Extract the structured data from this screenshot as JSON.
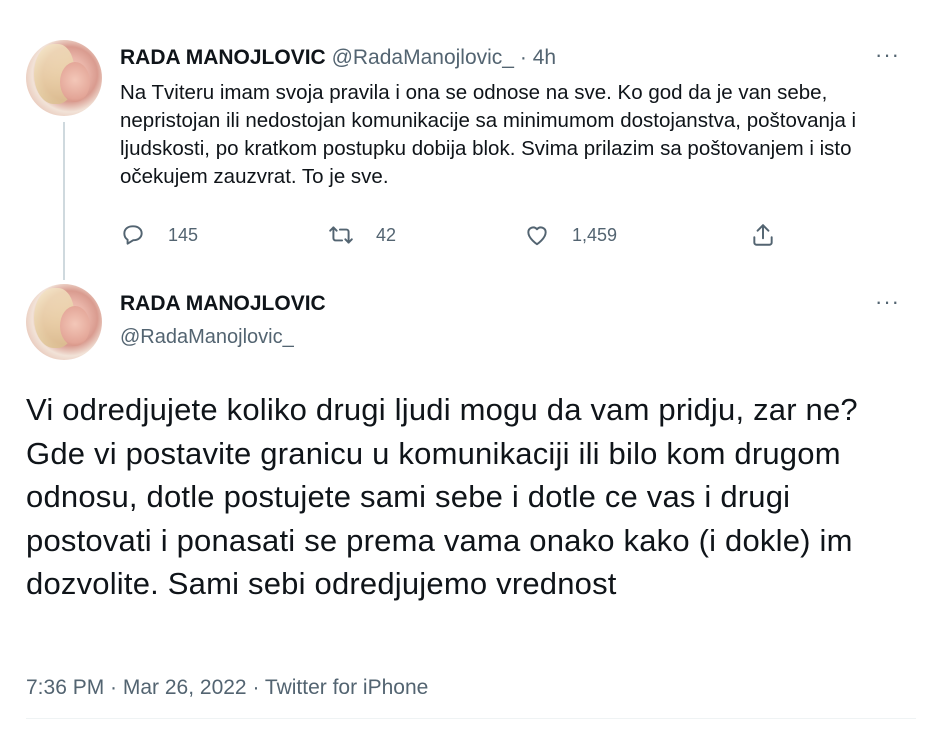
{
  "tweet1": {
    "name": "RADA MANOJLOVIC",
    "handle": "@RadaManojlovic_",
    "separator": "·",
    "time": "4h",
    "text": "Na Tviteru imam svoja pravila i ona se odnose na sve. Ko god da je van sebe, nepristojan ili nedostojan komunikacije sa minimumom dostojanstva, poštovanja i ljudskosti, po kratkom postupku dobija blok. Svima prilazim sa poštovanjem i isto očekujem zauzvrat. To je sve.",
    "more_label": "···",
    "actions": {
      "reply_count": "145",
      "retweet_count": "42",
      "like_count": "1,459"
    },
    "icons": {
      "reply": "reply-icon",
      "retweet": "retweet-icon",
      "like": "heart-icon",
      "share": "share-icon"
    }
  },
  "tweet2": {
    "name": "RADA MANOJLOVIC",
    "handle": "@RadaManojlovic_",
    "more_label": "···",
    "text": "Vi odredjujete koliko drugi ljudi mogu da vam pridju, zar ne? Gde vi postavite granicu u komunikaciji ili bilo kom drugom odnosu, dotle postujete sami sebe i dotle ce vas i drugi postovati i ponasati se prema vama onako kako (i dokle) im dozvolite. Sami sebi odredjujemo vrednost",
    "meta": "7:36 PM · Mar 26, 2022 · Twitter for iPhone"
  },
  "colors": {
    "text_primary": "#0f1419",
    "text_secondary": "#536471",
    "thread_line": "#cfd9de"
  }
}
